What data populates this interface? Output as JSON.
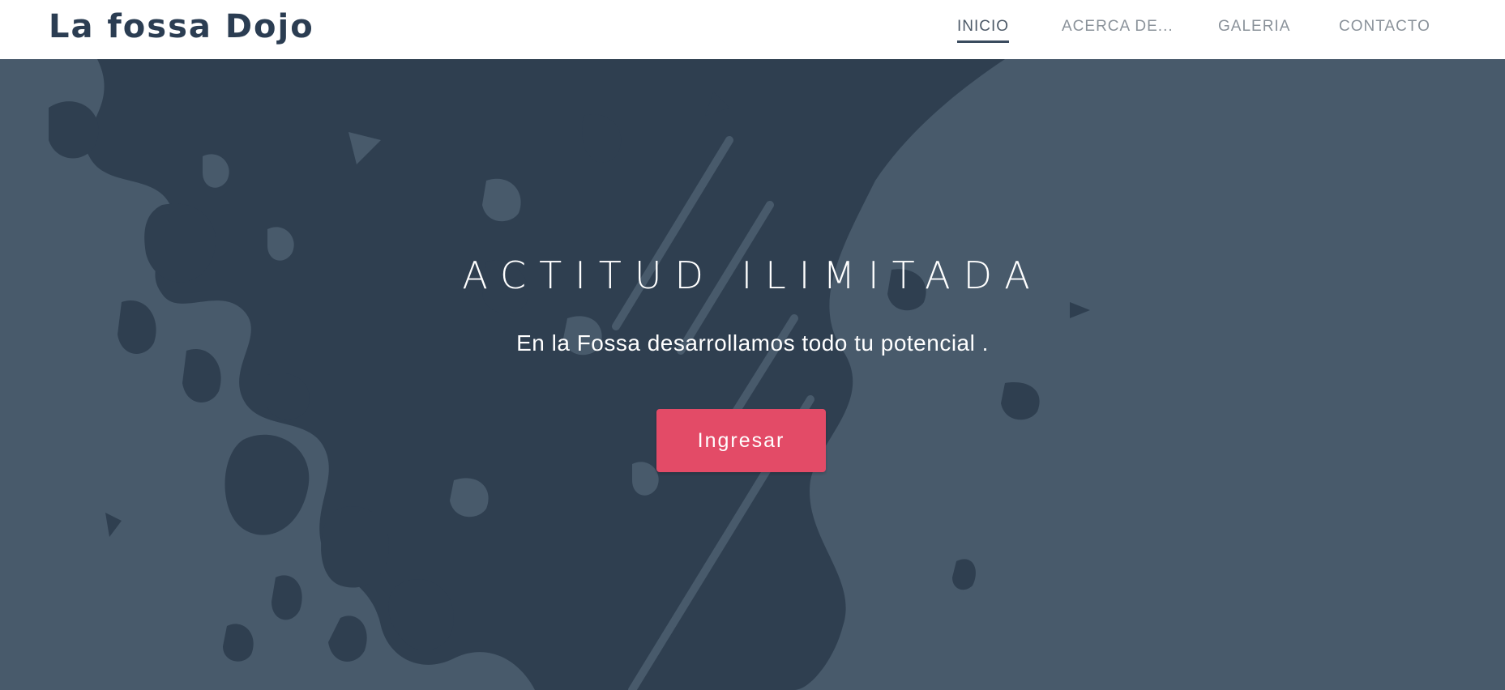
{
  "brand": {
    "name": "La fossa Dojo"
  },
  "nav": {
    "items": [
      {
        "label": "INICIO",
        "active": true
      },
      {
        "label": "ACERCA DE...",
        "active": false
      },
      {
        "label": "GALERIA",
        "active": false
      },
      {
        "label": "CONTACTO",
        "active": false
      }
    ]
  },
  "hero": {
    "title": "ACTITUD ILIMITADA",
    "subtitle": "En la Fossa desarrollamos todo tu potencial .",
    "cta_label": "Ingresar"
  },
  "colors": {
    "brand_text": "#2b3d52",
    "hero_background": "#485a6b",
    "splash": "#2f3f50",
    "accent_button": "#e34b67",
    "nav_inactive": "#8a929a",
    "nav_active": "#4d5a68"
  }
}
